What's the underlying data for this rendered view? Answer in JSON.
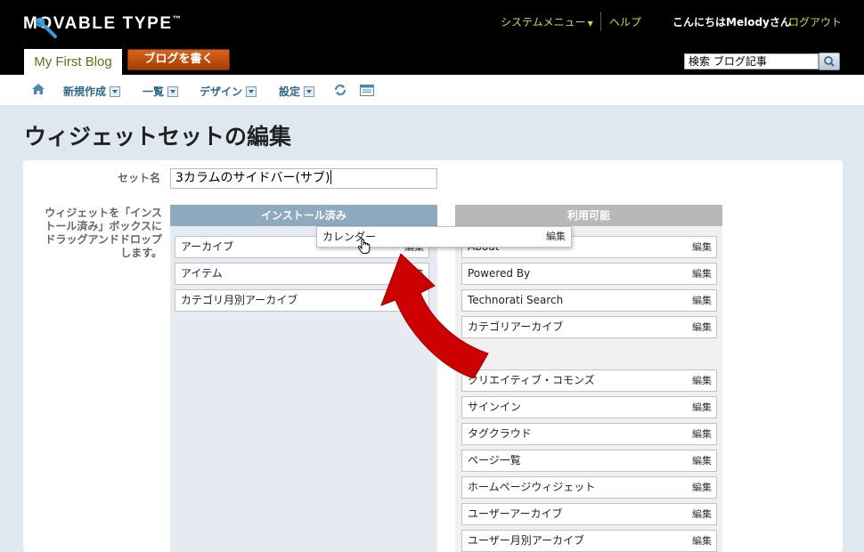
{
  "header": {
    "logo": "MOVABLE TYPE",
    "logo_tm": "™",
    "system_menu": "システムメニュー",
    "help": "ヘルプ",
    "greeting": "こんにちはMelodyさん",
    "logout": "ログアウト",
    "blog_tab": "My First Blog",
    "write_button": "ブログを書く",
    "search_value": "検索 ブログ記事"
  },
  "nav": {
    "items": [
      "新規作成",
      "一覧",
      "デザイン",
      "設定"
    ],
    "icons": [
      "home-icon",
      "refresh-icon",
      "view-site-icon"
    ]
  },
  "page": {
    "title": "ウィジェットセットの編集",
    "set_name_label": "セット名",
    "set_name_value": "3カラムのサイドバー(サブ)",
    "help_text": "ウィジェットを「インストール済み」ボックスにドラッグアンドドロップします。"
  },
  "installed": {
    "header": "インストール済み",
    "items": [
      "アーカイブ",
      "アイテム",
      "カテゴリ月別アーカイブ"
    ]
  },
  "available": {
    "header": "利用可能",
    "items": [
      "About",
      "Powered By",
      "Technorati Search",
      "カテゴリアーカイブ",
      "クリエイティブ・コモンズ",
      "サインイン",
      "タグクラウド",
      "ページ一覧",
      "ホームページウィジェット",
      "ユーザーアーカイブ",
      "ユーザー月別アーカイブ"
    ]
  },
  "edit_label": "編集",
  "dragging": {
    "label": "カレンダー"
  },
  "colors": {
    "accent": "#d8d24c",
    "installed_header": "#8daabe",
    "available_header": "#b8b8b8",
    "arrow": "#cc0000"
  }
}
